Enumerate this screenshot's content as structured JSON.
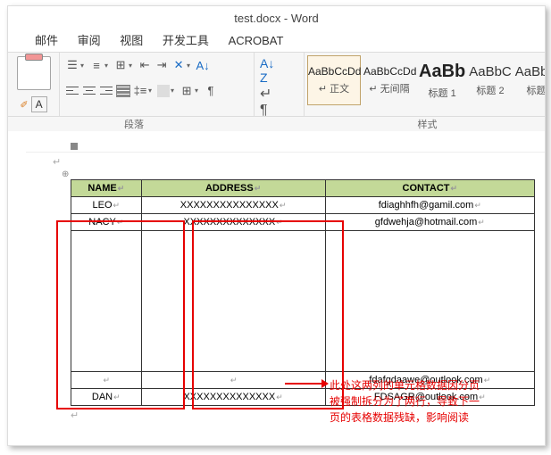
{
  "title": "test.docx - Word",
  "tabs": {
    "mail": "邮件",
    "review": "审阅",
    "view": "视图",
    "dev": "开发工具",
    "acrobat": "ACROBAT"
  },
  "ribbon": {
    "paragraph_label": "段落",
    "styles_label": "样式"
  },
  "styles": [
    {
      "preview": "AaBbCcDd",
      "name": "↵ 正文",
      "cls": ""
    },
    {
      "preview": "AaBbCcDd",
      "name": "↵ 无间隔",
      "cls": ""
    },
    {
      "preview": "AaBb",
      "name": "标题 1",
      "cls": "big"
    },
    {
      "preview": "AaBbC",
      "name": "标题 2",
      "cls": "med"
    },
    {
      "preview": "AaBbC",
      "name": "标题",
      "cls": "med"
    }
  ],
  "table": {
    "headers": {
      "name": "NAME",
      "address": "ADDRESS",
      "contact": "CONTACT"
    },
    "rows": [
      {
        "name": "LEO",
        "address": "XXXXXXXXXXXXXXX",
        "contact": "fdiaghhfh@gamil.com"
      },
      {
        "name": "NACY",
        "address": "XXXXXXXXXXXXXX",
        "contact": "gfdwehja@hotmail.com"
      },
      {
        "name": "",
        "address": "",
        "contact": ""
      },
      {
        "name": "",
        "address": "",
        "contact": "fdafgdaawe@outlook.com"
      },
      {
        "name": "DAN",
        "address": "XXXXXXXXXXXXXX",
        "contact": "FDSAGR@outlook.com"
      }
    ]
  },
  "annotation": "此处这两列的单元格数据因分页被强制拆分为了两行，导致下一页的表格数据残缺，影响阅读"
}
